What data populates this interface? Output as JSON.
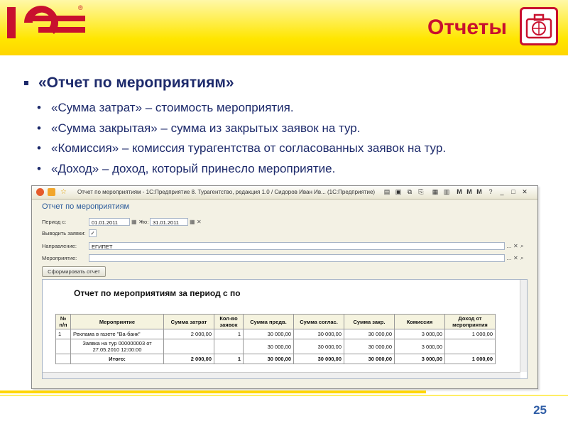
{
  "slide": {
    "title": "Отчеты",
    "main_bullet": "«Отчет по мероприятиям»",
    "sub_bullets": [
      "«Сумма затрат» – стоимость мероприятия.",
      "«Сумма закрытая» – сумма из закрытых заявок на тур.",
      "«Комиссия» – комиссия турагентства от согласованных заявок на тур.",
      "«Доход» – доход, который принесло мероприятие."
    ],
    "page_number": "25",
    "colors": {
      "brand_red": "#c8102e",
      "bar_yellow": "#ffe600",
      "text_blue": "#1d2a6b"
    }
  },
  "window": {
    "title": "Отчет по мероприятиям - 1С:Предприятие 8. Турагентство, редакция 1.0 / Сидоров Иван Ив... (1С:Предприятие)",
    "form_title": "Отчет по мероприятиям",
    "period_label": "Период с:",
    "period_from": "01.01.2011",
    "period_to_label": "по:",
    "period_to": "31.01.2011",
    "show_requests_label": "Выводить заявки:",
    "direction_label": "Направление:",
    "direction_value": "ЕГИПЕТ",
    "event_label": "Мероприятие:",
    "event_value": "",
    "generate_button": "Сформировать отчет",
    "report_title": "Отчет по мероприятиям за период с  по"
  },
  "report_table": {
    "headers": [
      "№ п/п",
      "Мероприятие",
      "Сумма затрат",
      "Кол-во заявок",
      "Сумма предв.",
      "Сумма соглас.",
      "Сумма закр.",
      "Комиссия",
      "Доход от мероприятия"
    ],
    "rows": [
      [
        "1",
        "Реклама в газете \"Ва-банк\"",
        "2 000,00",
        "1",
        "30 000,00",
        "30 000,00",
        "30 000,00",
        "3 000,00",
        "1 000,00"
      ],
      [
        "",
        "Заявка на тур 000000003 от 27.05.2010 12:00:00",
        "",
        "",
        "30 000,00",
        "30 000,00",
        "30 000,00",
        "3 000,00",
        ""
      ]
    ],
    "total": [
      "",
      "Итого:",
      "2 000,00",
      "1",
      "30 000,00",
      "30 000,00",
      "30 000,00",
      "3 000,00",
      "1 000,00"
    ]
  }
}
